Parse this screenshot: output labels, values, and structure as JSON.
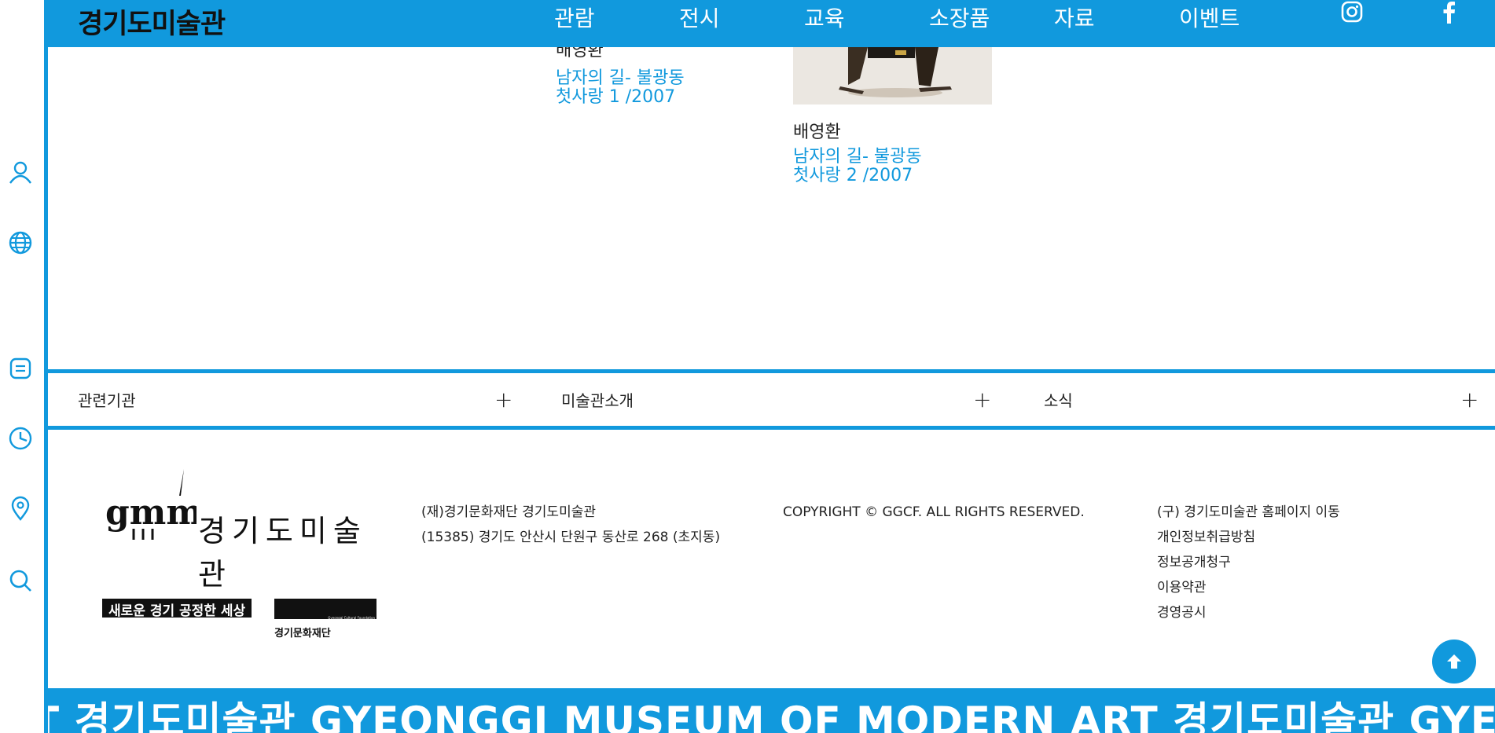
{
  "header": {
    "logo": "경기도미술관",
    "nav": [
      "관람",
      "전시",
      "교육",
      "소장품",
      "자료",
      "이벤트"
    ],
    "social": [
      "instagram-icon",
      "facebook-icon"
    ]
  },
  "artworks": [
    {
      "artist": "배영환",
      "title_line1": "남자의 길- 불광동",
      "title_line2": "첫사랑 1 /2007"
    },
    {
      "artist": "배영환",
      "title_line1": "남자의 길- 불광동",
      "title_line2": "첫사랑 2 /2007"
    }
  ],
  "sidebar_icons": [
    "user-icon",
    "globe-icon",
    "list-icon",
    "clock-icon",
    "location-pin-icon",
    "search-icon"
  ],
  "footer_menu": [
    {
      "label": "관련기관",
      "toggle": "+"
    },
    {
      "label": "미술관소개",
      "toggle": "+"
    },
    {
      "label": "소식",
      "toggle": "+"
    }
  ],
  "footer": {
    "logo_text": "경기도미술관",
    "logo_mark": "gmma",
    "slogan": "새로운 경기 공정한 세상",
    "foundation": "경기문화재단",
    "foundation_en": "Gyeonggi Cultural Foundation",
    "org": "(재)경기문화재단 경기도미술관",
    "address": "(15385) 경기도 안산시 단원구 동산로 268 (초지동)",
    "copyright": "COPYRIGHT © GGCF. ALL RIGHTS RESERVED.",
    "links": [
      "(구) 경기도미술관 홈페이지 이동",
      "개인정보취급방침",
      "정보공개청구",
      "이용약관",
      "경영공시"
    ]
  },
  "ticker": "T 경기도미술관 GYEONGGI MUSEUM OF MODERN ART 경기도미술관 GYEONGGI MUSEUM OF MODERN ART",
  "colors": {
    "accent": "#1199dd",
    "text": "#222222",
    "white": "#ffffff"
  }
}
